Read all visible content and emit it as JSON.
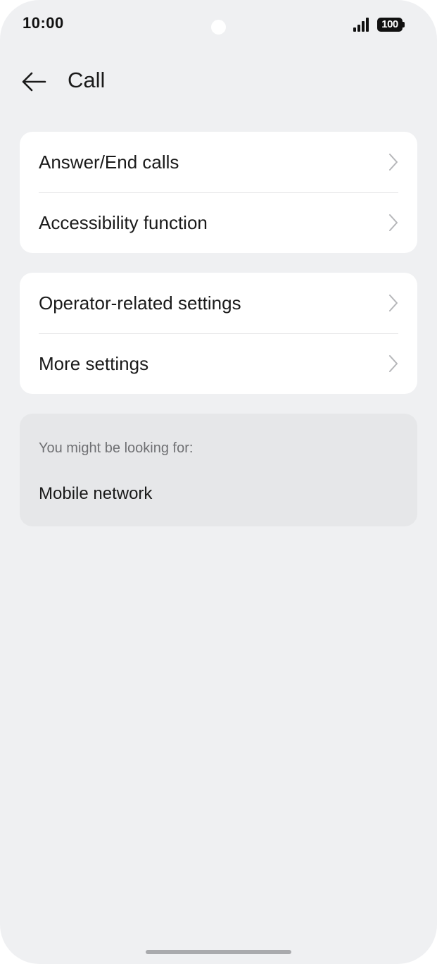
{
  "status_bar": {
    "time": "10:00",
    "battery_level": "100",
    "signal_icon": "signal-bars-icon",
    "battery_icon": "battery-icon"
  },
  "header": {
    "back_icon": "arrow-left-icon",
    "title": "Call"
  },
  "groups": [
    {
      "items": [
        {
          "label": "Answer/End calls",
          "icon": "chevron-right-icon"
        },
        {
          "label": "Accessibility function",
          "icon": "chevron-right-icon"
        }
      ]
    },
    {
      "items": [
        {
          "label": "Operator-related settings",
          "icon": "chevron-right-icon"
        },
        {
          "label": "More settings",
          "icon": "chevron-right-icon"
        }
      ]
    }
  ],
  "suggestions": {
    "caption": "You might be looking for:",
    "items": [
      "Mobile network"
    ]
  },
  "colors": {
    "background": "#eff0f2",
    "card": "#ffffff",
    "suggestion_card": "#e6e7e9",
    "chevron": "#b5b6b9"
  }
}
